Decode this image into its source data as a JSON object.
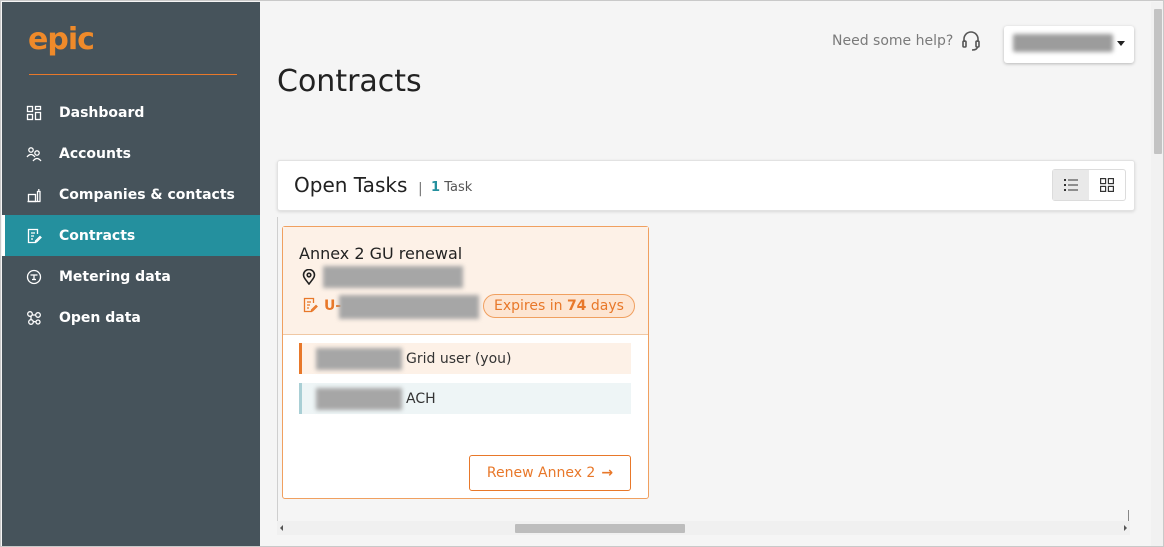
{
  "sidebar": {
    "logo": "epic",
    "items": [
      {
        "label": "Dashboard",
        "icon": "dashboard-icon",
        "active": false
      },
      {
        "label": "Accounts",
        "icon": "accounts-icon",
        "active": false
      },
      {
        "label": "Companies & contacts",
        "icon": "companies-icon",
        "active": false
      },
      {
        "label": "Contracts",
        "icon": "contracts-icon",
        "active": true
      },
      {
        "label": "Metering data",
        "icon": "metering-icon",
        "active": false
      },
      {
        "label": "Open data",
        "icon": "open-data-icon",
        "active": false
      }
    ]
  },
  "header": {
    "help_text": "Need some help?",
    "help_icon": "headset-icon"
  },
  "page": {
    "title": "Contracts"
  },
  "tasks": {
    "title": "Open Tasks",
    "separator": "|",
    "count": "1",
    "count_unit": "Task"
  },
  "card": {
    "title": "Annex 2 GU renewal",
    "contract_prefix": "U-",
    "expires_prefix": "Expires in",
    "expires_days": "74",
    "expires_suffix": "days",
    "parties": [
      {
        "role": "Grid user (you)"
      },
      {
        "role": "ACH"
      }
    ],
    "action_label": "Renew Annex 2",
    "action_arrow": "→"
  },
  "colors": {
    "sidebar_bg": "#46535b",
    "active_bg": "#24909e",
    "accent": "#e8782a",
    "teal": "#24909e"
  }
}
